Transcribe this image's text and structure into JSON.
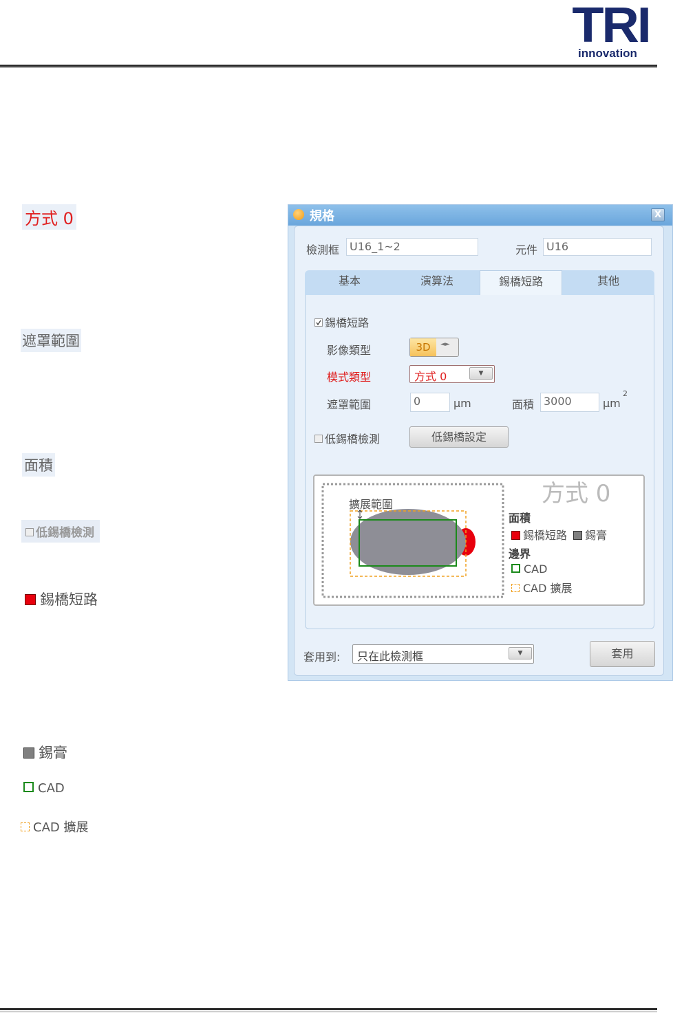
{
  "header": {
    "logo_main": "TRI",
    "logo_sub": "innovation"
  },
  "left_labels": {
    "mode": "方式 0",
    "mask_range": "遮罩範圍",
    "area": "面積",
    "low_bridge_detect": "低錫橋檢測",
    "solder_bridge": "錫橋短路",
    "solder_paste": "錫膏",
    "cad": "CAD",
    "cad_extend": "CAD 擴展"
  },
  "dialog": {
    "title": "規格",
    "close_label": "X",
    "inspect_box_label": "檢測框",
    "inspect_box_value": "U16_1~2",
    "component_label": "元件",
    "component_value": "U16",
    "tabs": [
      "基本",
      "演算法",
      "錫橋短路",
      "其他"
    ],
    "active_tab": "錫橋短路",
    "bridge_checkbox": "錫橋短路",
    "image_type_label": "影像類型",
    "image_type_value": "3D",
    "mode_type_label": "模式類型",
    "mode_type_value": "方式 0",
    "mask_label": "遮罩範圍",
    "mask_value": "0",
    "mask_unit": "μm",
    "area_label": "面積",
    "area_value": "3000",
    "area_unit": "μm",
    "area_unit_sup": "2",
    "low_bridge_checkbox": "低錫橋檢測",
    "low_bridge_button": "低錫橋設定",
    "diagram": {
      "title": "方式 0",
      "extend_label": "擴展範圍",
      "legend_area_heading": "面積",
      "legend_bridge": "錫橋短路",
      "legend_paste": "錫膏",
      "legend_border_heading": "邊界",
      "legend_cad": "CAD",
      "legend_cad_extend": "CAD 擴展"
    },
    "apply_to_label": "套用到:",
    "apply_to_value": "只在此檢測框",
    "apply_button": "套用"
  },
  "colors": {
    "bridge_red": "#e8000d",
    "paste_gray": "#808080",
    "cad_green": "#1b8a1b",
    "cad_extend_orange": "#f0a020",
    "dialog_title_blue": "#7ab2e2",
    "logo_navy": "#1a2a6c"
  }
}
